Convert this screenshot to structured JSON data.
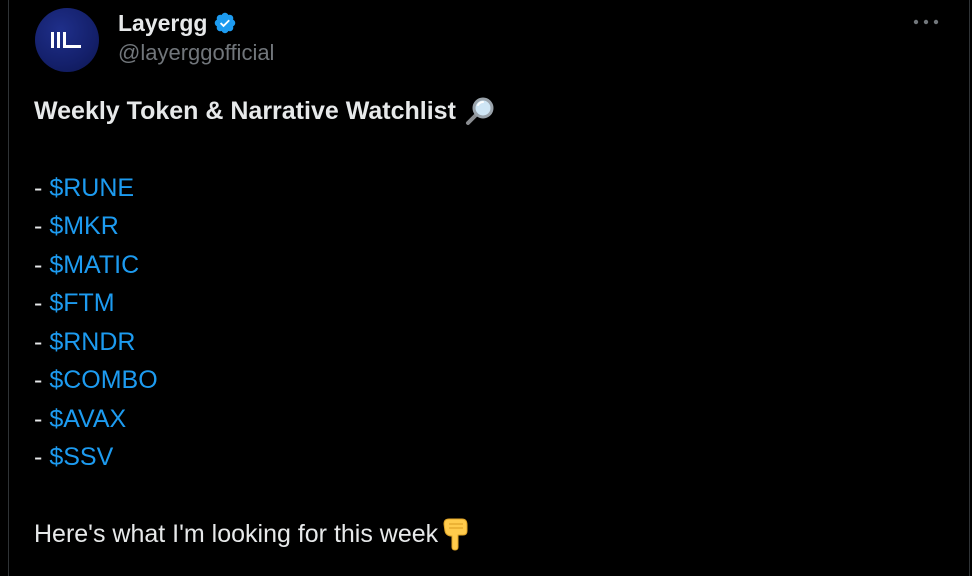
{
  "author": {
    "display_name": "Layergg",
    "handle": "@layerggofficial",
    "verified": true,
    "avatar_icon": "layergg-logo-icon",
    "brand_color": "#14206b"
  },
  "menu": {
    "more_icon": "more-horizontal-icon",
    "more_label": "···"
  },
  "tweet": {
    "title": "Weekly Token & Narrative Watchlist",
    "title_emoji": "magnifying-glass-icon",
    "dash": "-",
    "tokens": [
      {
        "label": "$RUNE"
      },
      {
        "label": "$MKR"
      },
      {
        "label": "$MATIC"
      },
      {
        "label": "$FTM"
      },
      {
        "label": "$RNDR"
      },
      {
        "label": "$COMBO"
      },
      {
        "label": "$AVAX"
      },
      {
        "label": "$SSV"
      }
    ],
    "closing": "Here's what I'm looking for this week",
    "closing_emoji": "pointing-down-icon"
  },
  "colors": {
    "background": "#000000",
    "text": "#e7e9ea",
    "secondary_text": "#71767b",
    "link": "#1d9bf0",
    "verified": "#1d9bf0"
  }
}
